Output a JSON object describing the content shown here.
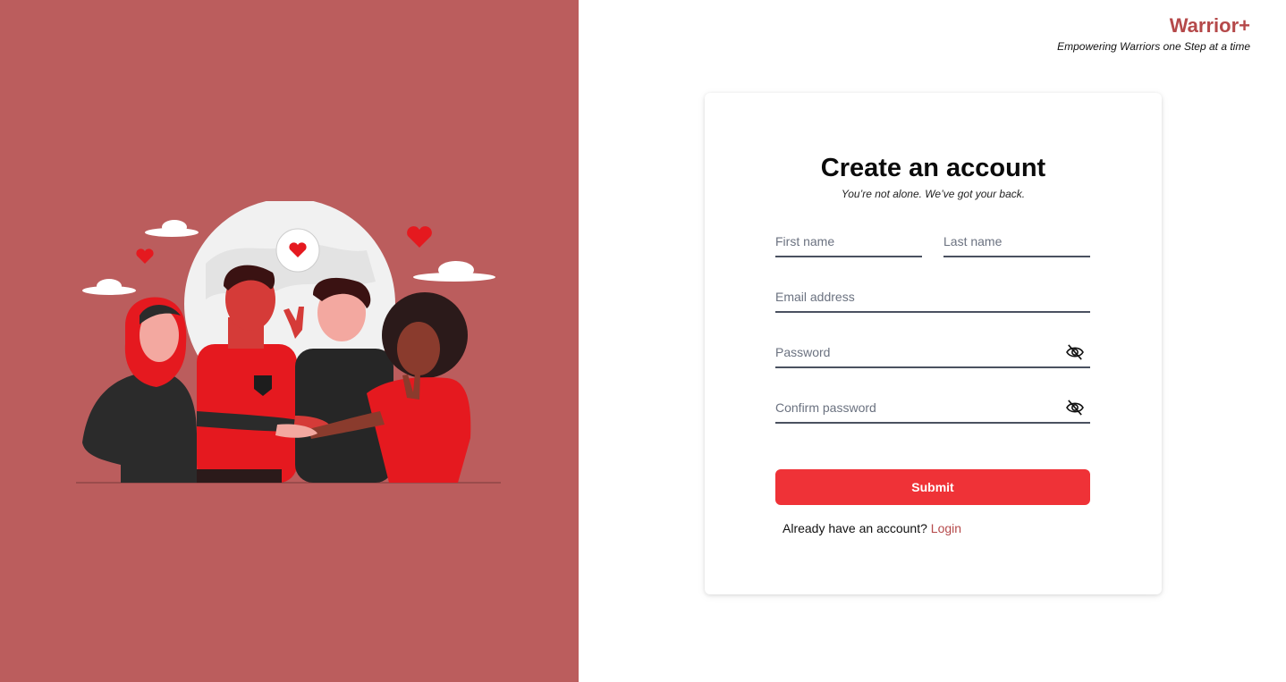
{
  "brand": {
    "name": "Warrior+",
    "tagline": "Empowering Warriors one Step at a time"
  },
  "form": {
    "title": "Create an account",
    "subtitle": "You’re not alone. We’ve got your back.",
    "first_name": {
      "placeholder": "First name",
      "value": ""
    },
    "last_name": {
      "placeholder": "Last name",
      "value": ""
    },
    "email": {
      "placeholder": "Email address",
      "value": ""
    },
    "password": {
      "placeholder": "Password",
      "value": "",
      "visibility_icon": "eye-off-icon"
    },
    "confirm_password": {
      "placeholder": "Confirm password",
      "value": "",
      "visibility_icon": "eye-off-icon"
    },
    "submit_label": "Submit",
    "login_prompt": "Already have an account?",
    "login_link": "Login"
  },
  "illustration": {
    "subject": "group-of-friends-stacking-hands-illustration",
    "elements": [
      "globe",
      "clouds",
      "heart-icon",
      "speech-bubble-heart-icon"
    ]
  },
  "colors": {
    "left_panel": "#bb5d5d",
    "brand": "#b5494a",
    "accent": "#ef3237",
    "input_border": "#4a5160"
  }
}
